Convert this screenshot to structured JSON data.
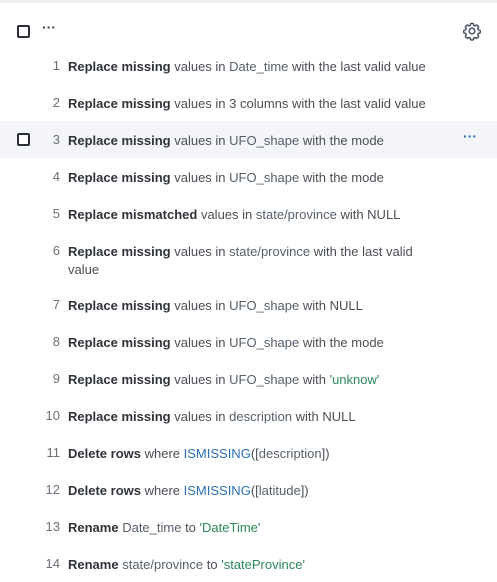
{
  "header": {
    "more_label": "···",
    "settings_icon": "gear-icon"
  },
  "steps": [
    {
      "num": "1",
      "action": "Replace missing",
      "parts": [
        " values in ",
        {
          "c": "Date_time"
        },
        " with the last valid value"
      ]
    },
    {
      "num": "2",
      "action": "Replace missing",
      "parts": [
        " values in 3 columns with the last valid value"
      ]
    },
    {
      "num": "3",
      "action": "Replace missing",
      "parts": [
        " values in ",
        {
          "c": "UFO_shape"
        },
        " with the mode"
      ],
      "hovered": true
    },
    {
      "num": "4",
      "action": "Replace missing",
      "parts": [
        " values in ",
        {
          "c": "UFO_shape"
        },
        " with the mode"
      ]
    },
    {
      "num": "5",
      "action": "Replace mismatched",
      "parts": [
        " values in ",
        {
          "c": "state/province"
        },
        " with NULL"
      ]
    },
    {
      "num": "6",
      "action": "Replace missing",
      "parts": [
        " values in ",
        {
          "c": "state/province"
        },
        " with the last valid value"
      ],
      "tall": true
    },
    {
      "num": "7",
      "action": "Replace missing",
      "parts": [
        " values in ",
        {
          "c": "UFO_shape"
        },
        " with NULL"
      ]
    },
    {
      "num": "8",
      "action": "Replace missing",
      "parts": [
        " values in ",
        {
          "c": "UFO_shape"
        },
        " with the mode"
      ]
    },
    {
      "num": "9",
      "action": "Replace missing",
      "parts": [
        " values in ",
        {
          "c": "UFO_shape"
        },
        " with ",
        {
          "s": "'unknow'"
        }
      ]
    },
    {
      "num": "10",
      "action": "Replace missing",
      "parts": [
        " values in ",
        {
          "c": "description"
        },
        " with NULL"
      ]
    },
    {
      "num": "11",
      "action": "Delete rows",
      "parts": [
        " where ",
        {
          "f": "ISMISSING"
        },
        "([",
        {
          "c": "description"
        },
        "])"
      ]
    },
    {
      "num": "12",
      "action": "Delete rows",
      "parts": [
        " where ",
        {
          "f": "ISMISSING"
        },
        "([",
        {
          "c": "latitude"
        },
        "])"
      ]
    },
    {
      "num": "13",
      "action": "Rename",
      "parts": [
        " ",
        {
          "c": "Date_time"
        },
        " to ",
        {
          "s": "'DateTime'"
        }
      ]
    },
    {
      "num": "14",
      "action": "Rename",
      "parts": [
        " ",
        {
          "c": "state/province"
        },
        " to ",
        {
          "s": "'stateProvince'"
        }
      ]
    }
  ],
  "hover_more_label": "···",
  "colors": {
    "hover_row": "#f3f5f9",
    "function": "#2a6fb8",
    "string": "#2c8a5a",
    "more_accent": "#2f6fc4"
  }
}
